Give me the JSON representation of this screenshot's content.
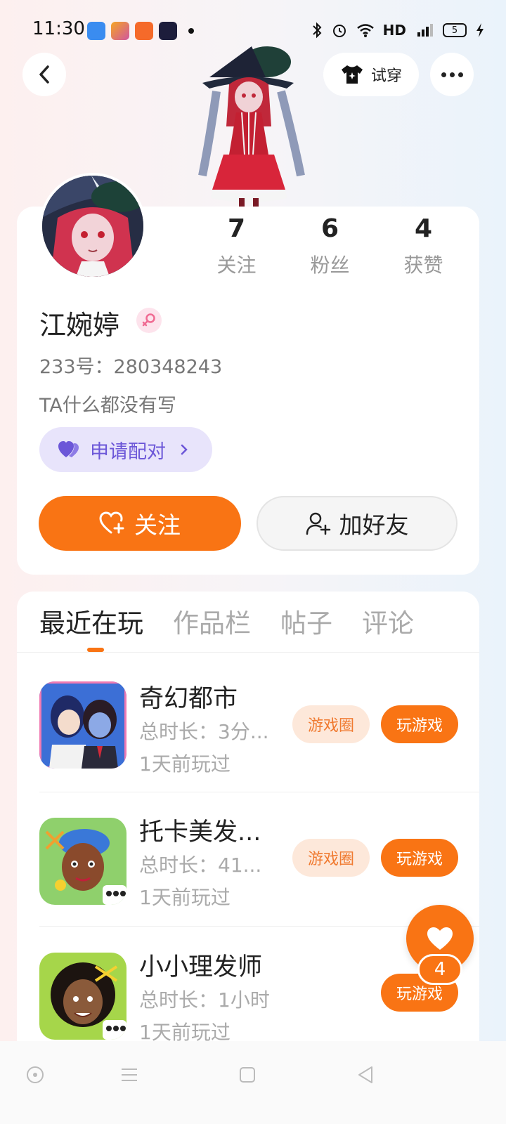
{
  "status_bar": {
    "time": "11:30",
    "network": "HD",
    "battery": "5"
  },
  "header": {
    "tryon_label": "试穿"
  },
  "profile": {
    "stats": [
      {
        "value": "7",
        "label": "关注"
      },
      {
        "value": "6",
        "label": "粉丝"
      },
      {
        "value": "4",
        "label": "获赞"
      }
    ],
    "username": "江婉婷",
    "user_id": "233号：280348243",
    "bio": "TA什么都没有写",
    "match_label": "申请配对",
    "follow_label": "关注",
    "add_friend_label": "加好友"
  },
  "tabs": [
    {
      "label": "最近在玩",
      "active": true
    },
    {
      "label": "作品栏",
      "active": false
    },
    {
      "label": "帖子",
      "active": false
    },
    {
      "label": "评论",
      "active": false
    }
  ],
  "games": [
    {
      "title": "奇幻都市",
      "duration": "总时长：3分...",
      "last_played": "1天前玩过",
      "circle_label": "游戏圈",
      "play_label": "玩游戏"
    },
    {
      "title": "托卡美发...",
      "duration": "总时长：41...",
      "last_played": "1天前玩过",
      "circle_label": "游戏圈",
      "play_label": "玩游戏"
    },
    {
      "title": "小小理发师",
      "duration": "总时长：1小时",
      "last_played": "1天前玩过",
      "play_label": "玩游戏"
    }
  ],
  "like_fab": {
    "count": "4"
  },
  "colors": {
    "accent": "#f97414",
    "match_purple": "#6c57d8",
    "match_bg": "#e8e4fb"
  }
}
